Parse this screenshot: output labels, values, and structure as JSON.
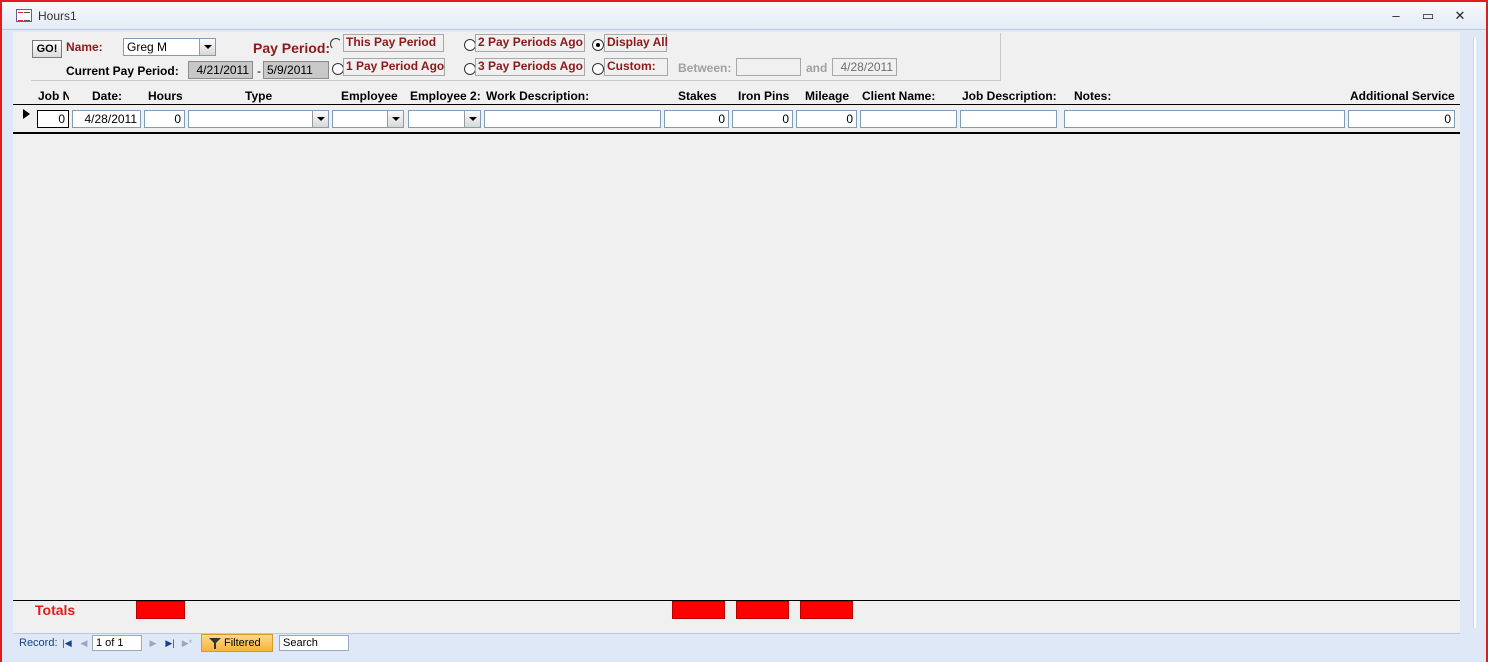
{
  "window": {
    "title": "Hours1",
    "minimize_glyph": "–",
    "maximize_glyph": "▭",
    "close_glyph": "✕"
  },
  "header": {
    "go_label": "GO!",
    "name_label": "Name:",
    "name_value": "Greg M",
    "current_pay_period_label": "Current Pay Period:",
    "period_start": "4/21/2011",
    "period_separator": "-",
    "period_end": "5/9/2011",
    "pay_period_label": "Pay Period:",
    "options": {
      "this_pay_period": "This Pay Period",
      "one_ago": "1 Pay Period Ago",
      "two_ago": "2 Pay Periods Ago",
      "three_ago": "3 Pay Periods Ago",
      "display_all": "Display All",
      "custom": "Custom:"
    },
    "selected_option": "display_all",
    "between_label": "Between:",
    "between_value": "",
    "and_label": "and",
    "and_value": "4/28/2011"
  },
  "columns": {
    "job_no": "Job N",
    "date": "Date:",
    "hours": "Hours",
    "type": "Type",
    "employee": "Employee",
    "employee2": "Employee 2:",
    "work_description": "Work Description:",
    "stakes": "Stakes",
    "iron_pins": "Iron Pins",
    "mileage": "Mileage",
    "client_name": "Client Name:",
    "job_description": "Job Description:",
    "notes": "Notes:",
    "additional_service": "Additional Service"
  },
  "row": {
    "job_no": "0",
    "date": "4/28/2011",
    "hours": "0",
    "type": "",
    "employee": "",
    "employee2": "",
    "work_description": "",
    "stakes": "0",
    "iron_pins": "0",
    "mileage": "0",
    "client_name": "",
    "job_description": "",
    "notes": "",
    "additional_service": "0"
  },
  "totals": {
    "label": "Totals",
    "highlight_color": "#ff0000"
  },
  "navigation": {
    "record_label": "Record:",
    "position": "1 of 1",
    "filter_status": "Filtered",
    "search_placeholder": "Search"
  },
  "colors": {
    "maroon_label": "#8b1a1a",
    "totals_red": "#e21b1b",
    "window_border": "#e21b1b"
  }
}
